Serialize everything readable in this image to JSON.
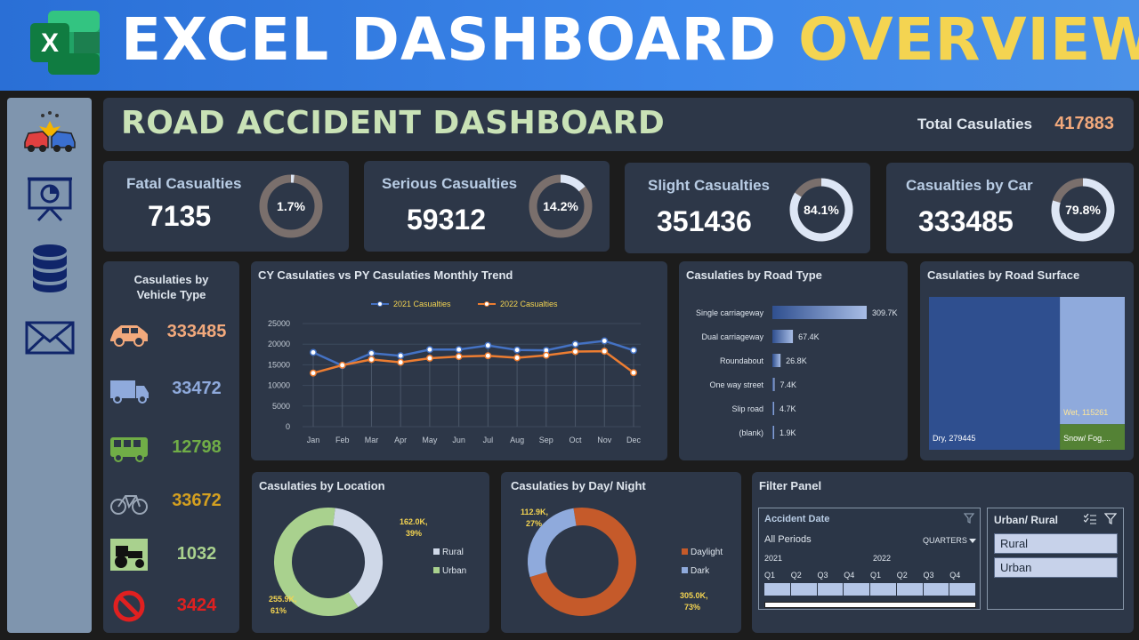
{
  "banner": {
    "title_main": "EXCEL DASHBOARD",
    "title_highlight": "OVERVIEW",
    "logo_letter": "X"
  },
  "sidebar": {
    "icons": [
      "car-crash-icon",
      "presentation-chart-icon",
      "database-icon",
      "mail-icon"
    ]
  },
  "header": {
    "title": "ROAD ACCIDENT DASHBOARD",
    "total_label": "Total Casulaties",
    "total_value": "417883"
  },
  "kpis": [
    {
      "label": "Fatal Casualties",
      "value": "7135",
      "pct_label": "1.7%",
      "pct": 1.7
    },
    {
      "label": "Serious Casualties",
      "value": "59312",
      "pct_label": "14.2%",
      "pct": 14.2
    },
    {
      "label": "Slight Casualties",
      "value": "351436",
      "pct_label": "84.1%",
      "pct": 84.1
    },
    {
      "label": "Casualties by Car",
      "value": "333485",
      "pct_label": "79.8%",
      "pct": 79.8
    }
  ],
  "vehicle": {
    "title_line1": "Casulaties by",
    "title_line2": "Vehicle Type",
    "rows": [
      {
        "icon": "car-icon",
        "value": "333485",
        "color": "#f2a97c"
      },
      {
        "icon": "truck-icon",
        "value": "33472",
        "color": "#8faadc"
      },
      {
        "icon": "bus-icon",
        "value": "12798",
        "color": "#70ad47"
      },
      {
        "icon": "bicycle-icon",
        "value": "33672",
        "color": "#d4a020"
      },
      {
        "icon": "tractor-icon",
        "value": "1032",
        "color": "#a9d18e"
      },
      {
        "icon": "no-entry-icon",
        "value": "3424",
        "color": "#e02020"
      }
    ]
  },
  "chart_data": [
    {
      "type": "line",
      "title": "CY Casulaties vs PY Casulaties Monthly Trend",
      "categories": [
        "Jan",
        "Feb",
        "Mar",
        "Apr",
        "May",
        "Jun",
        "Jul",
        "Aug",
        "Sep",
        "Oct",
        "Nov",
        "Dec"
      ],
      "series": [
        {
          "name": "2021 Casualties",
          "color": "#4472c4",
          "values": [
            18000,
            14800,
            17800,
            17200,
            18700,
            18700,
            19700,
            18600,
            18500,
            20000,
            20800,
            18500
          ]
        },
        {
          "name": "2022 Casualties",
          "color": "#ed7d31",
          "values": [
            13000,
            14900,
            16300,
            15600,
            16600,
            17000,
            17200,
            16700,
            17300,
            18200,
            18300,
            13100
          ]
        }
      ],
      "ylim": [
        0,
        25000
      ],
      "yticks": [
        "25000",
        "20000",
        "15000",
        "10000",
        "5000",
        "0"
      ],
      "grid": true,
      "legend": "top"
    },
    {
      "type": "bar",
      "title": "Casulaties by Road Type",
      "categories": [
        "Single carriageway",
        "Dual carriageway",
        "Roundabout",
        "One way street",
        "Slip road",
        "(blank)"
      ],
      "values": [
        309.7,
        67.4,
        26.8,
        7.4,
        4.7,
        1.9
      ],
      "value_labels": [
        "309.7K",
        "67.4K",
        "26.8K",
        "7.4K",
        "4.7K",
        "1.9K"
      ],
      "unit": "K"
    },
    {
      "type": "treemap",
      "title": "Casulaties by Road Surface",
      "items": [
        {
          "label": "Dry, 279445",
          "value": 279445,
          "color": "#2f4f8f"
        },
        {
          "label": "Wet, 115261",
          "value": 115261,
          "color": "#8faadc"
        },
        {
          "label": "Snow/ Fog,...",
          "value": 23177,
          "color": "#548235"
        }
      ]
    },
    {
      "type": "pie",
      "title": "Casulaties by Location",
      "slices": [
        {
          "name": "Rural",
          "value": 162.0,
          "label_value": "162.0K,",
          "label_pct": "39%",
          "color": "#cfd8e8"
        },
        {
          "name": "Urban",
          "value": 255.9,
          "label_value": "255.9K,",
          "label_pct": "61%",
          "color": "#a9d18e"
        }
      ],
      "legend": "right"
    },
    {
      "type": "pie",
      "title": "Casulaties by Day/ Night",
      "slices": [
        {
          "name": "Daylight",
          "value": 305.0,
          "label_value": "305.0K,",
          "label_pct": "73%",
          "color": "#c55a2a"
        },
        {
          "name": "Dark",
          "value": 112.9,
          "label_value": "112.9K,",
          "label_pct": "27%",
          "color": "#8faadc"
        }
      ],
      "legend": "right"
    }
  ],
  "filter_panel": {
    "title": "Filter Panel",
    "timeline": {
      "header": "Accident Date",
      "periods": "All Periods",
      "granularity": "QUARTERS",
      "years": [
        "2021",
        "2022"
      ],
      "quarters": [
        "Q1",
        "Q2",
        "Q3",
        "Q4",
        "Q1",
        "Q2",
        "Q3",
        "Q4"
      ]
    },
    "slicer": {
      "header": "Urban/ Rural",
      "options": [
        "Rural",
        "Urban"
      ]
    }
  }
}
